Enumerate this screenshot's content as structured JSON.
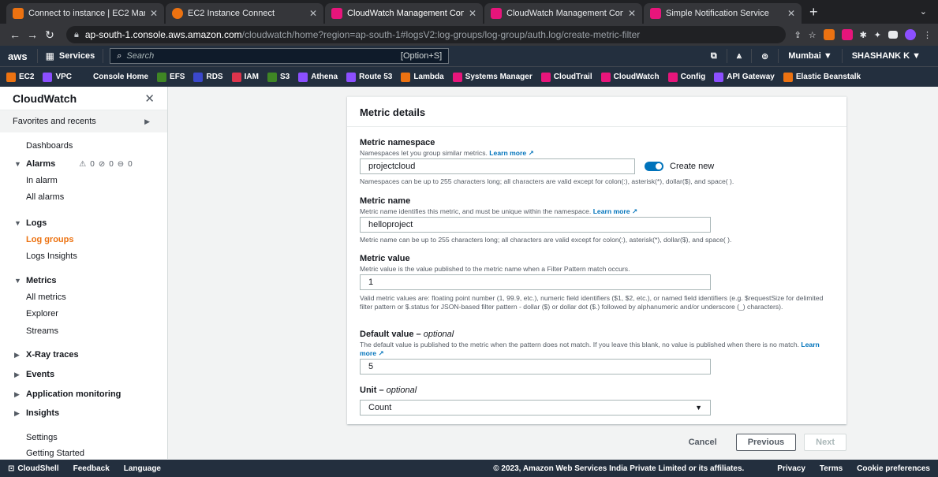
{
  "browser": {
    "tabs": [
      {
        "label": "Connect to instance | EC2 Man",
        "color": "#ec7211"
      },
      {
        "label": "EC2 Instance Connect",
        "color": "#ec7211"
      },
      {
        "label": "CloudWatch Management Con",
        "color": "#e7157b"
      },
      {
        "label": "CloudWatch Management Con",
        "color": "#e7157b"
      },
      {
        "label": "Simple Notification Service",
        "color": "#e7157b"
      }
    ],
    "new_tab": "+",
    "tab_menu": "⌄",
    "url_host": "ap-south-1.console.aws.amazon.com",
    "url_path": "/cloudwatch/home?region=ap-south-1#logsV2:log-groups/log-group/auth.log/create-metric-filter"
  },
  "awsnav": {
    "logo": "aws",
    "services": "Services",
    "search_placeholder": "Search",
    "search_shortcut": "[Option+S]",
    "region": "Mumbai ▼",
    "user": "SHASHANK K ▼"
  },
  "favorites": [
    {
      "label": "EC2",
      "color": "#ec7211"
    },
    {
      "label": "VPC",
      "color": "#8c4fff"
    },
    {
      "label": "Console Home",
      "color": "#232f3e"
    },
    {
      "label": "EFS",
      "color": "#3f8624"
    },
    {
      "label": "RDS",
      "color": "#3b48cc"
    },
    {
      "label": "IAM",
      "color": "#dd344c"
    },
    {
      "label": "S3",
      "color": "#3f8624"
    },
    {
      "label": "Athena",
      "color": "#8c4fff"
    },
    {
      "label": "Route 53",
      "color": "#8c4fff"
    },
    {
      "label": "Lambda",
      "color": "#ec7211"
    },
    {
      "label": "Systems Manager",
      "color": "#e7157b"
    },
    {
      "label": "CloudTrail",
      "color": "#e7157b"
    },
    {
      "label": "CloudWatch",
      "color": "#e7157b"
    },
    {
      "label": "Config",
      "color": "#e7157b"
    },
    {
      "label": "API Gateway",
      "color": "#8c4fff"
    },
    {
      "label": "Elastic Beanstalk",
      "color": "#ec7211"
    }
  ],
  "sidebar": {
    "title": "CloudWatch",
    "favorites": "Favorites and recents",
    "dashboards": "Dashboards",
    "alarms": "Alarms",
    "alarm_counts": [
      "0",
      "0",
      "0"
    ],
    "in_alarm": "In alarm",
    "all_alarms": "All alarms",
    "logs": "Logs",
    "log_groups": "Log groups",
    "logs_insights": "Logs Insights",
    "metrics": "Metrics",
    "all_metrics": "All metrics",
    "explorer": "Explorer",
    "streams": "Streams",
    "xray": "X-Ray traces",
    "events": "Events",
    "app_monitoring": "Application monitoring",
    "insights": "Insights",
    "settings": "Settings",
    "getting_started": "Getting Started"
  },
  "form": {
    "title": "Metric details",
    "namespace": {
      "label": "Metric namespace",
      "desc": "Namespaces let you group similar metrics.",
      "learn": "Learn more",
      "value": "projectcloud",
      "toggle": "Create new",
      "constraint": "Namespaces can be up to 255 characters long; all characters are valid except for colon(:), asterisk(*), dollar($), and space( )."
    },
    "name": {
      "label": "Metric name",
      "desc": "Metric name identifies this metric, and must be unique within the namespace.",
      "learn": "Learn more",
      "value": "helloproject",
      "constraint": "Metric name can be up to 255 characters long; all characters are valid except for colon(:), asterisk(*), dollar($), and space( )."
    },
    "value": {
      "label": "Metric value",
      "desc": "Metric value is the value published to the metric name when a Filter Pattern match occurs.",
      "value": "1",
      "constraint": "Valid metric values are: floating point number (1, 99.9, etc.), numeric field identifiers ($1, $2, etc.), or named field identifiers (e.g. $requestSize for delimited filter pattern or $.status for JSON-based filter pattern - dollar ($) or dollar dot ($.) followed by alphanumeric and/or underscore (_) characters)."
    },
    "default": {
      "label": "Default value – ",
      "optional": "optional",
      "desc": "The default value is published to the metric when the pattern does not match. If you leave this blank, no value is published when there is no match.",
      "learn": "Learn more",
      "value": "5"
    },
    "unit": {
      "label": "Unit – ",
      "optional": "optional",
      "value": "Count"
    },
    "cancel": "Cancel",
    "previous": "Previous",
    "next": "Next"
  },
  "footer": {
    "cloudshell": "CloudShell",
    "feedback": "Feedback",
    "language": "Language",
    "copyright": "© 2023, Amazon Web Services India Private Limited or its affiliates.",
    "privacy": "Privacy",
    "terms": "Terms",
    "cookies": "Cookie preferences"
  }
}
